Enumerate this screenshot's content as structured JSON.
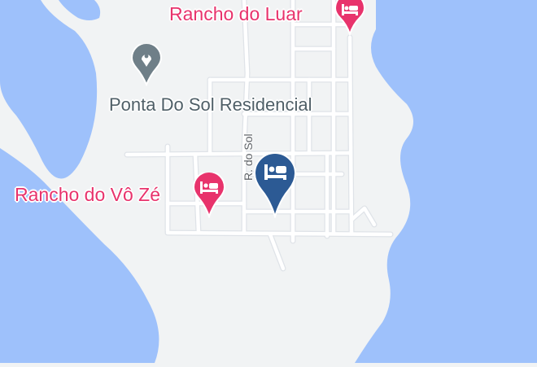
{
  "map": {
    "colors": {
      "land": "#f1f3f4",
      "water": "#9ec1fb",
      "road": "#ffffff",
      "road_outline": "#dfe3e8",
      "hotel_pin": "#e8336c",
      "residential_pin": "#6f7f88",
      "selected_pin": "#2c5a94"
    },
    "labels": {
      "rancho_do_luar": "Rancho do Luar",
      "ponta_do_sol": "Ponta Do Sol Residencial",
      "rancho_vo_ze": "Rancho do Vô Zé",
      "road_sol": "R. do Sol"
    },
    "icons": {
      "hotel": "bed-icon",
      "residential": "location-dot-icon",
      "selected": "bed-icon"
    }
  }
}
